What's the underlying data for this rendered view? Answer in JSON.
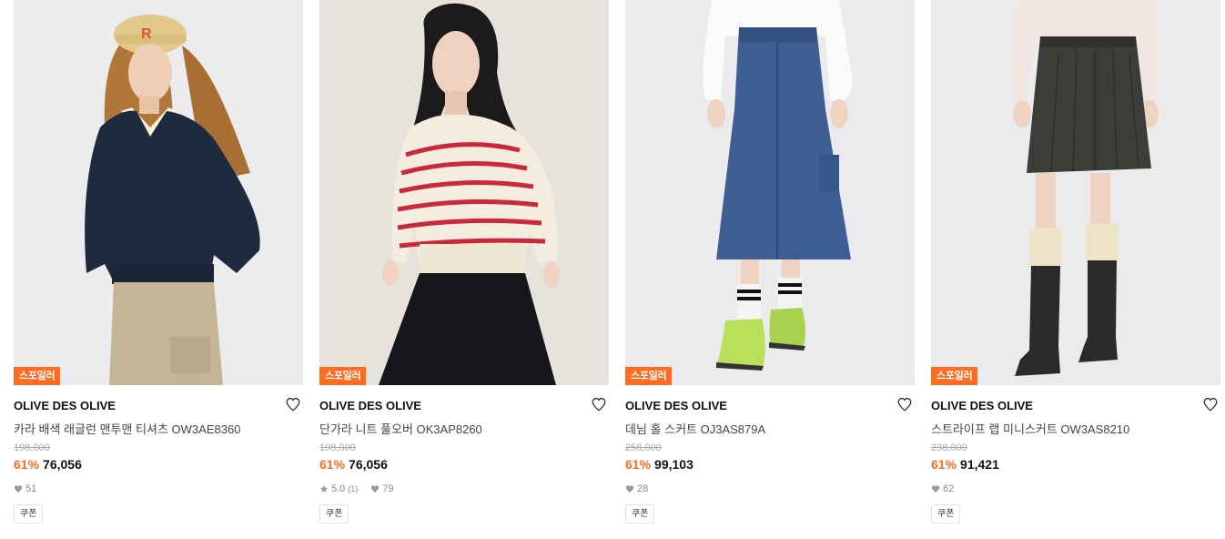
{
  "colors": {
    "accent": "#ff6b1f"
  },
  "products": [
    {
      "badge": "스포일러",
      "brand": "OLIVE DES OLIVE",
      "name": "카라 배색 래글런 맨투맨 티셔츠 OW3AE8360",
      "original_price": "198,000",
      "discount": "61%",
      "price": "76,056",
      "rating": "",
      "rating_count": "",
      "likes": "51",
      "coupon": "쿠폰",
      "image": "woman-in-cap-navy-sweatshirt"
    },
    {
      "badge": "스포일러",
      "brand": "OLIVE DES OLIVE",
      "name": "단가라 니트 풀오버 OK3AP8260",
      "original_price": "198,000",
      "discount": "61%",
      "price": "76,056",
      "rating": "5.0",
      "rating_count": "(1)",
      "likes": "79",
      "coupon": "쿠폰",
      "image": "woman-striped-knit-pullover"
    },
    {
      "badge": "스포일러",
      "brand": "OLIVE DES OLIVE",
      "name": "데님 홀 스커트 OJ3AS879A",
      "original_price": "258,000",
      "discount": "61%",
      "price": "99,103",
      "rating": "",
      "rating_count": "",
      "likes": "28",
      "coupon": "쿠폰",
      "image": "denim-midi-skirt-sneakers"
    },
    {
      "badge": "스포일러",
      "brand": "OLIVE DES OLIVE",
      "name": "스트라이프 랩 미니스커트 OW3AS8210",
      "original_price": "238,000",
      "discount": "61%",
      "price": "91,421",
      "rating": "",
      "rating_count": "",
      "likes": "62",
      "coupon": "쿠폰",
      "image": "striped-mini-skirt-boots"
    }
  ]
}
